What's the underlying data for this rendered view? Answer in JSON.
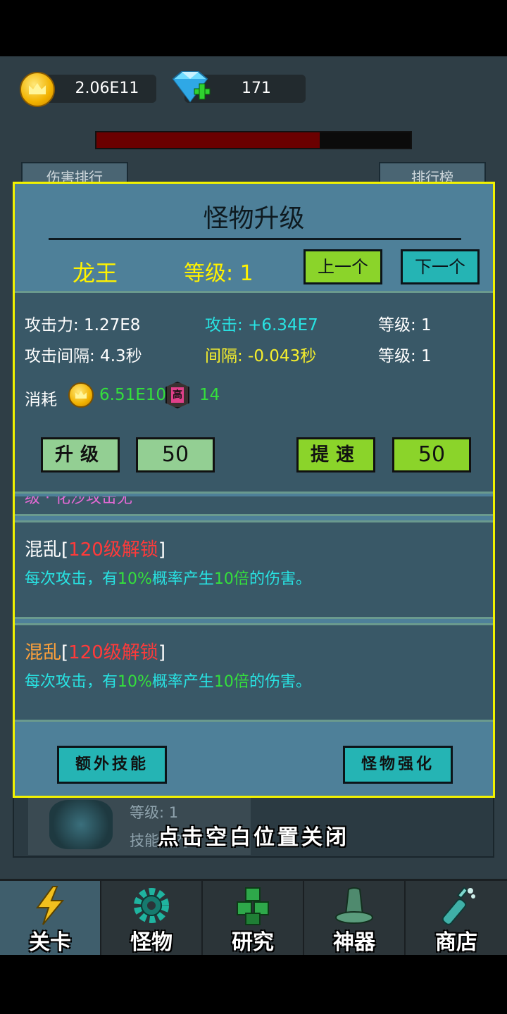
{
  "currency": {
    "gold": "2.06E11",
    "gems": "171"
  },
  "hp": {
    "fraction": 0.71
  },
  "background": {
    "tab_left": "伤害排行",
    "tab_right": "排行榜",
    "card_level": "等级: 1",
    "card_skill": "技能: [?]"
  },
  "modal": {
    "title": "怪物升级",
    "monster_name": "龙王",
    "level": "等级: 1",
    "prev_label": "上一个",
    "next_label": "下一个",
    "stats": {
      "attack": "攻击力: 1.27E8",
      "attack_gain": "攻击: +6.34E7",
      "attack_level": "等级: 1",
      "interval": "攻击间隔: 4.3秒",
      "interval_gain": "间隔: -0.043秒",
      "interval_level": "等级: 1"
    },
    "cost": {
      "label": "消耗",
      "gold": "6.51E10",
      "badge_char": "高",
      "badge_count": "14"
    },
    "upgrade_label": "升级",
    "upgrade_value": "50",
    "speed_label": "提速",
    "speed_value": "50",
    "cut_skill_text": "级 · 化沙攻击无",
    "skills": [
      {
        "name": "混乱",
        "unlock": "120级解锁",
        "desc_a": "每次攻击，有",
        "desc_pct": "10%",
        "desc_b": "概率产生",
        "desc_mult": "10倍",
        "desc_c": "的伤害。"
      },
      {
        "name": "混乱",
        "unlock": "120级解锁",
        "desc_a": "每次攻击，有",
        "desc_pct": "10%",
        "desc_b": "概率产生",
        "desc_mult": "10倍",
        "desc_c": "的伤害。"
      }
    ],
    "extra_skill_label": "额外技能",
    "enhance_label": "怪物强化"
  },
  "close_hint": "点击空白位置关闭",
  "nav": [
    {
      "label": "关卡",
      "icon": "lightning-icon"
    },
    {
      "label": "怪物",
      "icon": "gear-icon"
    },
    {
      "label": "研究",
      "icon": "cubes-icon"
    },
    {
      "label": "神器",
      "icon": "hat-icon"
    },
    {
      "label": "商店",
      "icon": "bottle-icon"
    }
  ],
  "colors": {
    "modal_bg": "#4e8099",
    "modal_border": "#f2f200",
    "panel_bg": "#395867",
    "highlight_yellow": "#fff200",
    "green_text": "#34e03c",
    "cyan_text": "#28e3e3",
    "red_text": "#ff3a3a"
  }
}
